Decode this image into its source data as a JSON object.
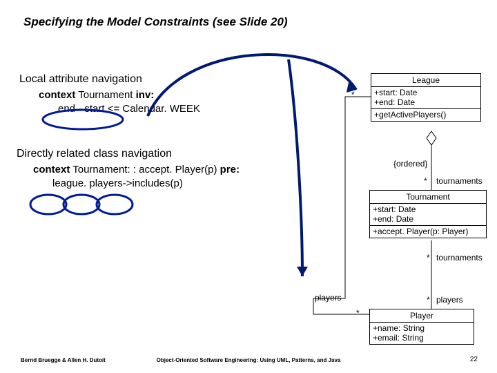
{
  "title": "Specifying the Model Constraints (see Slide 20)",
  "sections": {
    "s1": {
      "heading": "Local attribute navigation",
      "line1a": "context",
      "line1b": " Tournament ",
      "line1c": "inv:",
      "line2": "end - start  <= Calendar. WEEK"
    },
    "s2": {
      "heading": "Directly related class navigation",
      "line1a": "context",
      "line1b": " Tournament: : accept. Player(p) ",
      "line1c": "pre:",
      "line2": "league. players->includes(p)"
    }
  },
  "uml": {
    "league": {
      "name": "League",
      "attrs": [
        "+start: Date",
        "+end: Date"
      ],
      "ops": [
        "+getActivePlayers()"
      ]
    },
    "tournament": {
      "name": "Tournament",
      "attrs": [
        "+start: Date",
        "+end: Date"
      ],
      "ops": [
        "+accept. Player(p: Player)"
      ]
    },
    "player": {
      "name": "Player",
      "attrs": [
        "+name: String",
        "+email: String"
      ]
    }
  },
  "labels": {
    "star": "*",
    "ordered": "{ordered}",
    "tournaments": "tournaments",
    "players": "players"
  },
  "footer": {
    "left": "Bernd Bruegge & Allen H. Dutoit",
    "center": "Object-Oriented Software Engineering: Using UML, Patterns, and Java",
    "page": "22"
  }
}
